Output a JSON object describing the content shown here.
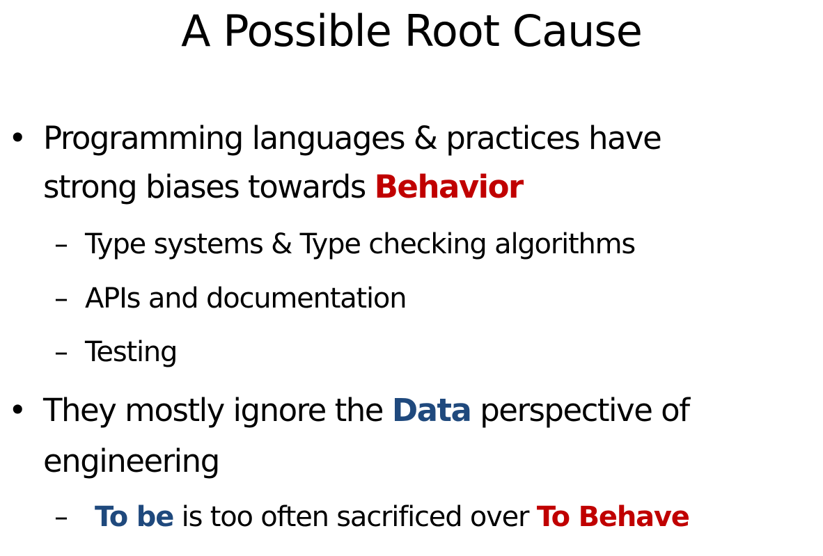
{
  "title": "A Possible Root Cause",
  "bullets": [
    {
      "text_lines": [
        "Programming languages & practices have",
        "strong biases towards "
      ],
      "emphasis": "Behavior",
      "sub": [
        "Type systems & Type checking algorithms",
        "APIs and documentation",
        "Testing"
      ]
    },
    {
      "pre": "They mostly ignore the ",
      "emphasis": "Data",
      "post": " perspective of",
      "line2": "engineering",
      "sub": {
        "em1": "To be",
        "mid": " is too often sacrificed over ",
        "em2": "To Behave"
      }
    }
  ],
  "colors": {
    "red": "#C00000",
    "blue": "#1F497D"
  }
}
